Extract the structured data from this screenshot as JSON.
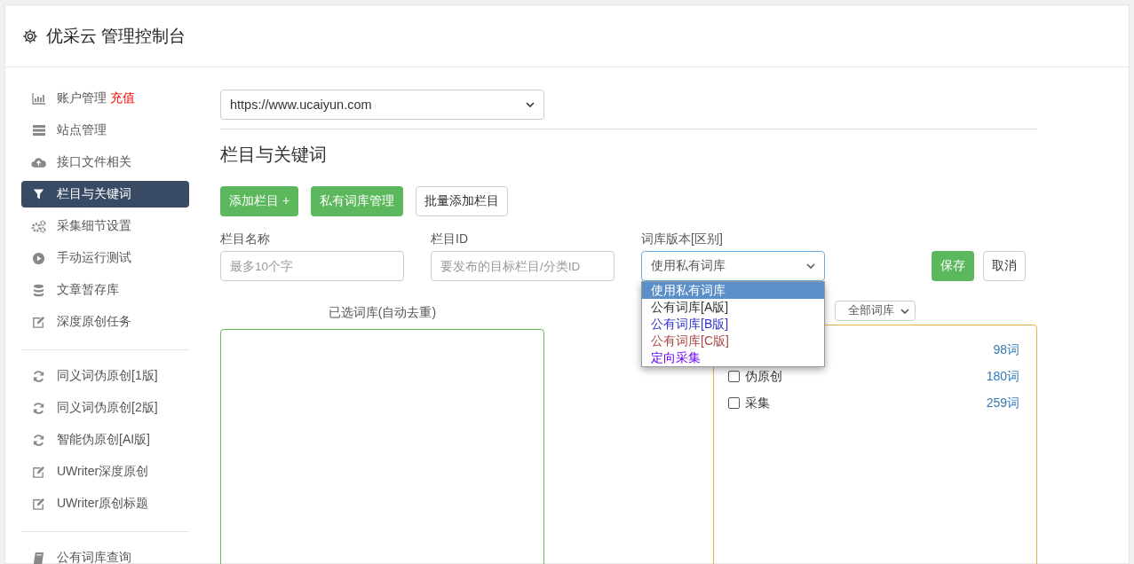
{
  "header": {
    "title": "优采云 管理控制台"
  },
  "sidebar": {
    "groups": [
      {
        "items": [
          {
            "label": "账户管理",
            "badge": "充值",
            "selected": false
          },
          {
            "label": "站点管理",
            "selected": false
          },
          {
            "label": "接口文件相关",
            "selected": false
          },
          {
            "label": "栏目与关键词",
            "selected": true
          },
          {
            "label": "采集细节设置",
            "selected": false
          },
          {
            "label": "手动运行测试",
            "selected": false
          },
          {
            "label": "文章暂存库",
            "selected": false
          },
          {
            "label": "深度原创任务",
            "selected": false
          }
        ]
      },
      {
        "items": [
          {
            "label": "同义词伪原创[1版]",
            "selected": false
          },
          {
            "label": "同义词伪原创[2版]",
            "selected": false
          },
          {
            "label": "智能伪原创[AI版]",
            "selected": false
          },
          {
            "label": "UWriter深度原创",
            "selected": false
          },
          {
            "label": "UWriter原创标题",
            "selected": false
          }
        ]
      },
      {
        "items": [
          {
            "label": "公有词库查询",
            "selected": false
          }
        ]
      }
    ]
  },
  "site_select": {
    "value": "https://www.ucaiyun.com"
  },
  "heading": "栏目与关键词",
  "toolbar": [
    {
      "label": "添加栏目 +",
      "kind": "primary"
    },
    {
      "label": "私有词库管理",
      "kind": "primary"
    },
    {
      "label": "批量添加栏目",
      "kind": "default"
    }
  ],
  "form": {
    "name_field": {
      "label": "栏目名称",
      "placeholder": "最多10个字"
    },
    "id_field": {
      "label": "栏目ID",
      "placeholder": "要发布的目标栏目/分类ID"
    },
    "version_select": {
      "label": "词库版本[区别]",
      "value": "使用私有词库",
      "expanded": true,
      "options": [
        {
          "label": "使用私有词库",
          "selected": true
        },
        {
          "label": "公有词库[A版]",
          "selected": false,
          "color": "#333333"
        },
        {
          "label": "公有词库[B版]",
          "selected": false,
          "color": "#3333cc"
        },
        {
          "label": "公有词库[C版]",
          "selected": false,
          "color": "#aa4444"
        },
        {
          "label": "定向采集",
          "selected": false,
          "color": "#6600ff"
        }
      ]
    },
    "save_button": "保存",
    "cancel_button": "取消"
  },
  "selected_panel": {
    "title": "已选词库(自动去重)"
  },
  "library_panel": {
    "filter": "全部词库",
    "items": [
      {
        "count": "98词"
      },
      {
        "label": "伪原创",
        "count": "180词",
        "checked": false
      },
      {
        "label": "采集",
        "count": "259词",
        "checked": false
      }
    ]
  }
}
